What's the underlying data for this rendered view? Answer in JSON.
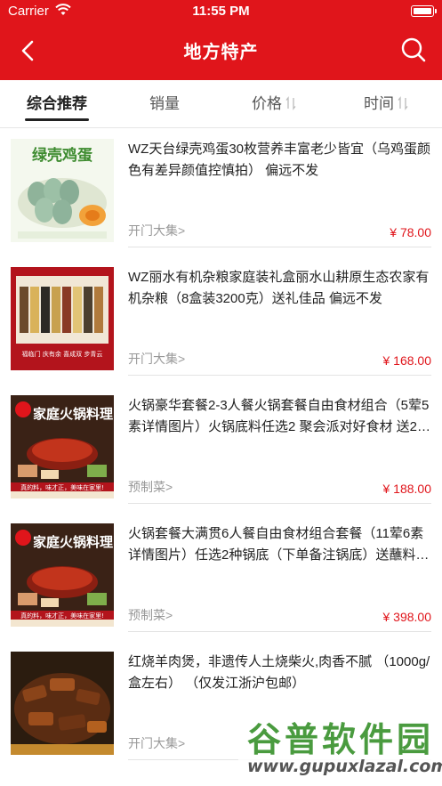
{
  "status_bar": {
    "carrier": "Carrier",
    "time": "11:55 PM"
  },
  "nav": {
    "title": "地方特产"
  },
  "tabs": [
    {
      "label": "综合推荐",
      "active": true,
      "sortable": false
    },
    {
      "label": "销量",
      "active": false,
      "sortable": false
    },
    {
      "label": "价格",
      "active": false,
      "sortable": true
    },
    {
      "label": "时间",
      "active": false,
      "sortable": true
    }
  ],
  "items": [
    {
      "title": "WZ天台绿壳鸡蛋30枚营养丰富老少皆宜（乌鸡蛋颜色有差异颜值控慎拍） 偏远不发",
      "shop": "开门大集>",
      "price": "¥ 78.00",
      "thumb_text": "绿壳鸡蛋"
    },
    {
      "title": "WZ丽水有机杂粮家庭装礼盒丽水山耕原生态农家有机杂粮（8盒装3200克）送礼佳品 偏远不发",
      "shop": "开门大集>",
      "price": "¥ 168.00",
      "thumb_text": "福临门 庆有余 喜成双 步青云"
    },
    {
      "title": "火锅豪华套餐2-3人餐火锅套餐自由食材组合（5荤5素详情图片）火锅底料任选2 聚会派对好食材 送2…",
      "shop": "预制菜>",
      "price": "¥ 188.00",
      "thumb_text": "家庭火锅料理",
      "thumb_caption": "真的料，味才正，美味在家里!"
    },
    {
      "title": "火锅套餐大满贯6人餐自由食材组合套餐（11荤6素详情图片）任选2种锅底（下单备注锅底）送蘸料…",
      "shop": "预制菜>",
      "price": "¥ 398.00",
      "thumb_text": "家庭火锅料理",
      "thumb_caption": "真的料，味才正，美味在家里!"
    },
    {
      "title": "红烧羊肉煲，非遗传人土烧柴火,肉香不腻 （1000g/盒左右） （仅发江浙沪包邮）",
      "shop": "开门大集>",
      "price": "",
      "thumb_text": ""
    }
  ],
  "watermark": {
    "big": "谷普软件园",
    "small": "www.gupuxlazal.com"
  },
  "colors": {
    "brand_red": "#e0151b",
    "price_red": "#e0151b"
  }
}
